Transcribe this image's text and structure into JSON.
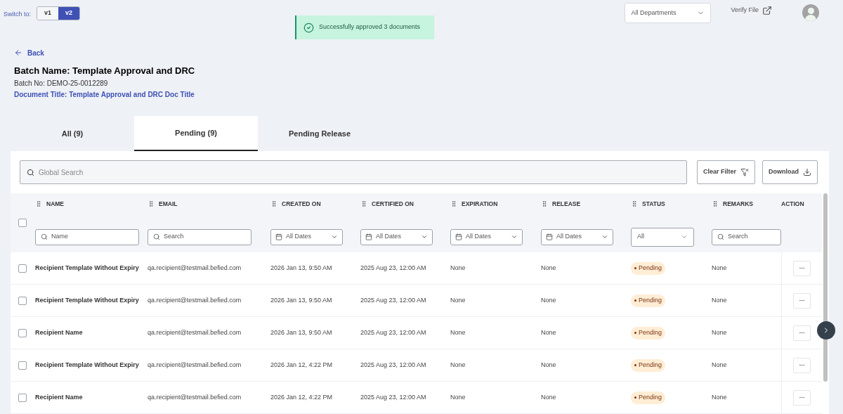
{
  "version_switch": {
    "label": "Switch to:",
    "options": [
      {
        "label": "v1",
        "selected": false
      },
      {
        "label": "v2",
        "selected": true
      }
    ]
  },
  "toast": {
    "message": "Successfully approved 3 documents"
  },
  "department_select": {
    "value": "All Departments"
  },
  "verify_link": "Verify File",
  "back": "Back",
  "batch": {
    "name": "Batch Name: Template Approval and DRC",
    "number": "Batch No: DEMO-25-0012289",
    "document_title": "Document Title: Template Approval and DRC Doc Title"
  },
  "tabs": [
    {
      "label": "All (9)",
      "selected": false
    },
    {
      "label": "Pending (9)",
      "selected": true
    },
    {
      "label": "Pending Release",
      "selected": false
    }
  ],
  "global_search": {
    "placeholder": "Global Search"
  },
  "buttons": [
    {
      "label": "Clear Filter",
      "kind": "filter"
    },
    {
      "label": "Download",
      "kind": "download"
    }
  ],
  "table": {
    "select_all_checked": false,
    "columns": [
      {
        "label": "NAME",
        "draggable": true,
        "filter": {
          "kind": "search",
          "placeholder": "Name"
        }
      },
      {
        "label": "EMAIL",
        "draggable": true,
        "filter": {
          "kind": "search",
          "placeholder": "Search"
        }
      },
      {
        "label": "CREATED ON",
        "draggable": true,
        "filter": {
          "kind": "date",
          "value": "All Dates"
        }
      },
      {
        "label": "CERTIFIED ON",
        "draggable": true,
        "filter": {
          "kind": "date",
          "value": "All Dates"
        }
      },
      {
        "label": "EXPIRATION",
        "draggable": true,
        "filter": {
          "kind": "date",
          "value": "All Dates"
        }
      },
      {
        "label": "RELEASE",
        "draggable": true,
        "filter": {
          "kind": "date",
          "value": "All Dates"
        }
      },
      {
        "label": "STATUS",
        "draggable": true,
        "filter": {
          "kind": "select",
          "value": "All"
        }
      },
      {
        "label": "REMARKS",
        "draggable": true,
        "filter": {
          "kind": "search",
          "placeholder": "Search"
        }
      },
      {
        "label": "ACTION",
        "draggable": false
      }
    ],
    "rows": [
      {
        "checked": false,
        "name": "Recipient Template Without Expiry",
        "email": "qa.recipient@testmail.befied.com",
        "created_on": "2026 Jan 13, 9:50 AM",
        "certified_on": "2025 Aug 23, 12:00 AM",
        "expiration": "None",
        "release": "None",
        "status": {
          "label": "Pending",
          "kind": "pending"
        },
        "remarks": "None"
      },
      {
        "checked": false,
        "name": "Recipient Template Without Expiry",
        "email": "qa.recipient@testmail.befied.com",
        "created_on": "2026 Jan 13, 9:50 AM",
        "certified_on": "2025 Aug 23, 12:00 AM",
        "expiration": "None",
        "release": "None",
        "status": {
          "label": "Pending",
          "kind": "pending"
        },
        "remarks": "None"
      },
      {
        "checked": false,
        "name": "Recipient Name",
        "email": "qa.recipient@testmail.befied.com",
        "created_on": "2026 Jan 13, 9:50 AM",
        "certified_on": "2025 Aug 23, 12:00 AM",
        "expiration": "None",
        "release": "None",
        "status": {
          "label": "Pending",
          "kind": "pending"
        },
        "remarks": "None"
      },
      {
        "checked": false,
        "name": "Recipient Template Without Expiry",
        "email": "qa.recipient@testmail.befied.com",
        "created_on": "2026 Jan 12, 4:22 PM",
        "certified_on": "2025 Aug 23, 12:00 AM",
        "expiration": "None",
        "release": "None",
        "status": {
          "label": "Pending",
          "kind": "pending"
        },
        "remarks": "None"
      },
      {
        "checked": false,
        "name": "Recipient Name",
        "email": "qa.recipient@testmail.befied.com",
        "created_on": "2026 Jan 12, 4:22 PM",
        "certified_on": "2025 Aug 23, 12:00 AM",
        "expiration": "None",
        "release": "None",
        "status": {
          "label": "Pending",
          "kind": "pending"
        },
        "remarks": "None"
      }
    ]
  }
}
